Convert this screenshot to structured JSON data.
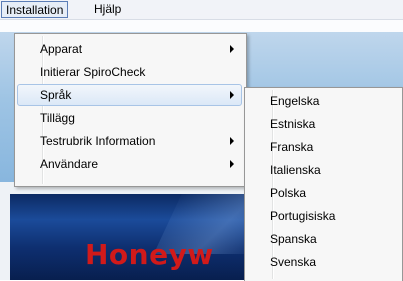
{
  "menubar": {
    "items": [
      {
        "label": "Installation",
        "active": true
      },
      {
        "label": "Hjälp",
        "active": false
      }
    ]
  },
  "installation_menu": {
    "items": [
      {
        "label": "Apparat",
        "submenu": true
      },
      {
        "label": "Initierar SpiroCheck",
        "submenu": false
      },
      {
        "label": "Språk",
        "submenu": true,
        "highlighted": true
      },
      {
        "label": "Tillägg",
        "submenu": false
      },
      {
        "label": "Testrubrik Information",
        "submenu": true
      },
      {
        "label": "Användare",
        "submenu": true
      }
    ]
  },
  "language_submenu": {
    "items": [
      {
        "label": "Engelska"
      },
      {
        "label": "Estniska"
      },
      {
        "label": "Franska"
      },
      {
        "label": "Italienska"
      },
      {
        "label": "Polska"
      },
      {
        "label": "Portugisiska"
      },
      {
        "label": "Spanska"
      },
      {
        "label": "Svenska"
      }
    ]
  },
  "background": {
    "brand_text": "Honeyw",
    "brand_color": "#d11a1a"
  }
}
